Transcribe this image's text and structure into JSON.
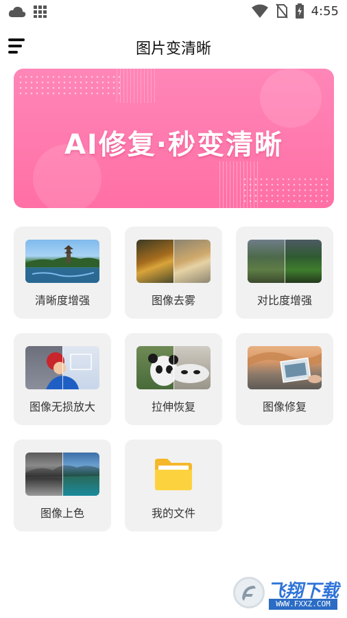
{
  "status_bar": {
    "time": "4:55",
    "icons": [
      "cloud-icon",
      "grid-icon",
      "wifi-icon",
      "no-sim-icon",
      "battery-charging-icon"
    ]
  },
  "app_bar": {
    "title": "图片变清晰",
    "menu_icon": "menu-icon"
  },
  "banner": {
    "text": "AI修复·秒变清晰",
    "colors": {
      "start": "#ff86b8",
      "end": "#ff6fa5"
    }
  },
  "features": [
    {
      "label": "清晰度增强",
      "icon": "lake-pagoda-photo"
    },
    {
      "label": "图像去雾",
      "icon": "autumn-forest-photo"
    },
    {
      "label": "对比度增强",
      "icon": "green-hills-photo"
    },
    {
      "label": "图像无损放大",
      "icon": "child-snow-photo"
    },
    {
      "label": "拉伸恢复",
      "icon": "panda-photo"
    },
    {
      "label": "图像修复",
      "icon": "plaza-photo"
    },
    {
      "label": "图像上色",
      "icon": "lake-colorize-photo"
    },
    {
      "label": "我的文件",
      "icon": "folder-icon"
    }
  ],
  "watermark": {
    "text": "飞翔下载",
    "url": "WWW.FXXZ.COM"
  }
}
